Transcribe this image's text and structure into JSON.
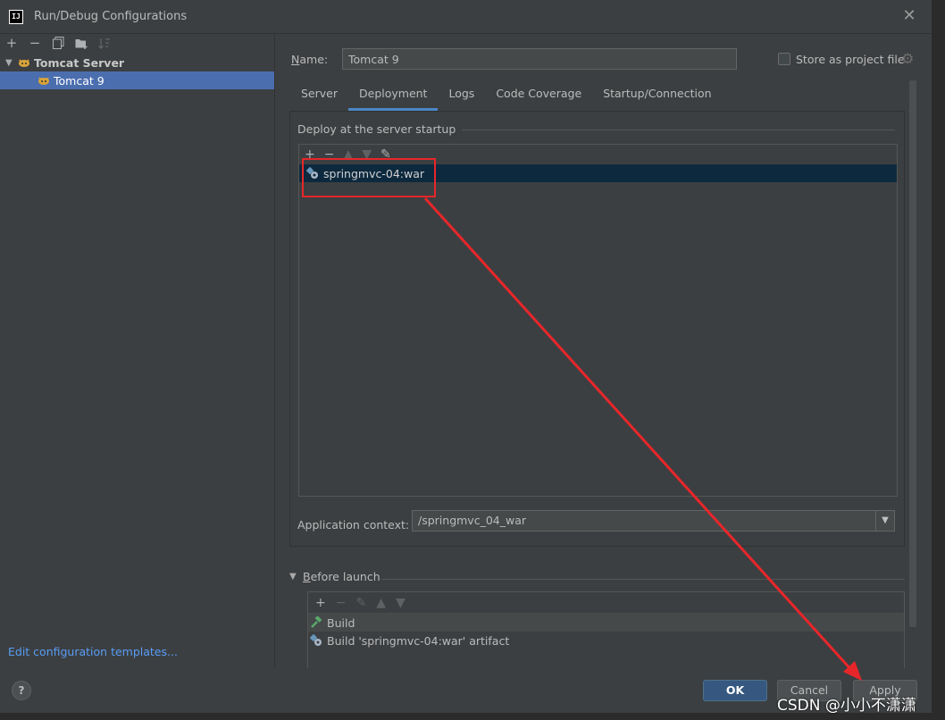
{
  "window": {
    "title": "Run/Debug Configurations",
    "app_icon": "IJ"
  },
  "left_toolbar": {
    "icons": [
      "add-icon",
      "remove-icon",
      "copy-icon",
      "folder-icon",
      "sort-icon"
    ]
  },
  "tree": {
    "root_label": "Tomcat Server",
    "child_label": "Tomcat 9"
  },
  "edit_templates_link": "Edit configuration templates...",
  "name_field": {
    "label_prefix": "N",
    "label_rest": "ame:",
    "value": "Tomcat 9"
  },
  "store_as_project_file": {
    "label": "Store as project file",
    "checked": false
  },
  "tabs": [
    {
      "label": "Server"
    },
    {
      "label": "Deployment"
    },
    {
      "label": "Logs"
    },
    {
      "label": "Code Coverage"
    },
    {
      "label": "Startup/Connection"
    }
  ],
  "active_tab": "Deployment",
  "deploy": {
    "section_title": "Deploy at the server startup",
    "artifact": "springmvc-04:war",
    "context_label": "Application context:",
    "context_value": "/springmvc_04_war"
  },
  "before_launch": {
    "title_prefix": "B",
    "title_rest": "efore launch",
    "items": [
      {
        "label": "Build"
      },
      {
        "label": "Build 'springmvc-04:war' artifact"
      }
    ]
  },
  "buttons": {
    "help": "?",
    "ok": "OK",
    "cancel": "Cancel",
    "apply": "Apply"
  },
  "watermark": "CSDN @小小不潇潇",
  "colors": {
    "background": "#3c3f41",
    "selection": "#4b6eaf",
    "list_selection": "#0d293e",
    "link": "#589df6",
    "ok_button": "#365880",
    "annotation": "#e8262a"
  }
}
